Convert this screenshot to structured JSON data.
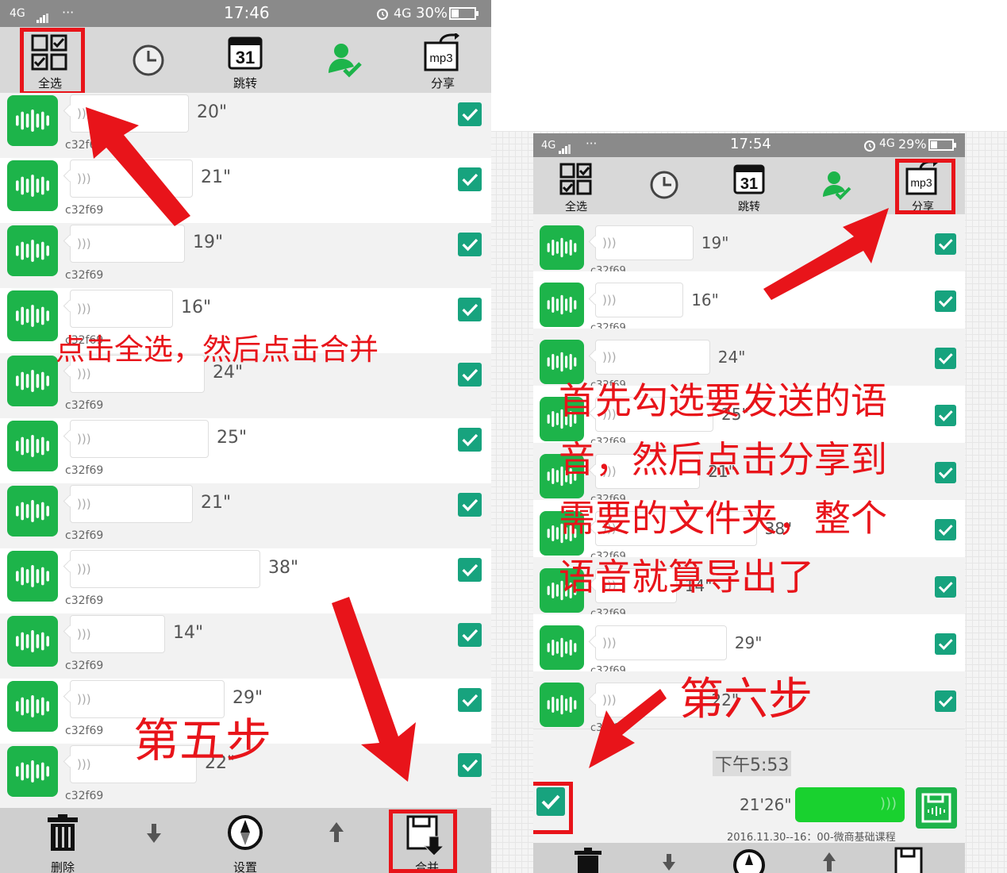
{
  "left_phone": {
    "status": {
      "signal": "4G",
      "dots": "···",
      "time": "17:46",
      "network": "4G",
      "battery": "30%"
    },
    "toolbar": {
      "select_all": "全选",
      "jump": "跳转",
      "share": "分享",
      "calendar_day": "31",
      "mp3": "mp3"
    },
    "rows": [
      {
        "duration": "20\"",
        "user": "c32f69"
      },
      {
        "duration": "21\"",
        "user": "c32f69"
      },
      {
        "duration": "19\"",
        "user": "c32f69"
      },
      {
        "duration": "16\"",
        "user": "c32f69"
      },
      {
        "duration": "24\"",
        "user": "c32f69"
      },
      {
        "duration": "25\"",
        "user": "c32f69"
      },
      {
        "duration": "21\"",
        "user": "c32f69"
      },
      {
        "duration": "38\"",
        "user": "c32f69"
      },
      {
        "duration": "14\"",
        "user": "c32f69"
      },
      {
        "duration": "29\"",
        "user": "c32f69"
      },
      {
        "duration": "22\"",
        "user": "c32f69"
      }
    ],
    "bottom": {
      "delete": "删除",
      "settings": "设置",
      "merge": "合并"
    },
    "annotation_main": "点击全选，然后点击合并",
    "annotation_step": "第五步"
  },
  "right_phone": {
    "status": {
      "signal": "4G",
      "dots": "···",
      "time": "17:54",
      "network": "4G",
      "battery": "29%"
    },
    "toolbar": {
      "select_all": "全选",
      "jump": "跳转",
      "share": "分享",
      "calendar_day": "31",
      "mp3": "mp3"
    },
    "rows": [
      {
        "duration": "19\"",
        "user": "c32f69"
      },
      {
        "duration": "16\"",
        "user": "c32f69"
      },
      {
        "duration": "24\"",
        "user": "c32f69"
      },
      {
        "duration": "25\"",
        "user": "c32f69"
      },
      {
        "duration": "21\"",
        "user": "c32f69"
      },
      {
        "duration": "38\"",
        "user": "c32f69"
      },
      {
        "duration": "14\"",
        "user": "c32f69"
      },
      {
        "duration": "29\"",
        "user": "c32f69"
      },
      {
        "duration": "22\"",
        "user": "c32f69"
      }
    ],
    "merged": {
      "time": "下午5:53",
      "duration": "21'26\"",
      "caption": "2016.11.30--16：00-微商基础课程"
    },
    "annotation_main": "首先勾选要发送的语音，然后点击分享到需要的文件夹，整个语音就算导出了",
    "annotation_lines": [
      "首先勾选要发送的语",
      "音，然后点击分享到",
      "需要的文件夹，整个",
      "语音就算导出了"
    ],
    "annotation_step": "第六步"
  },
  "colors": {
    "accent_red": "#e8141a",
    "green": "#1db44a",
    "teal_check": "#17a37e"
  }
}
